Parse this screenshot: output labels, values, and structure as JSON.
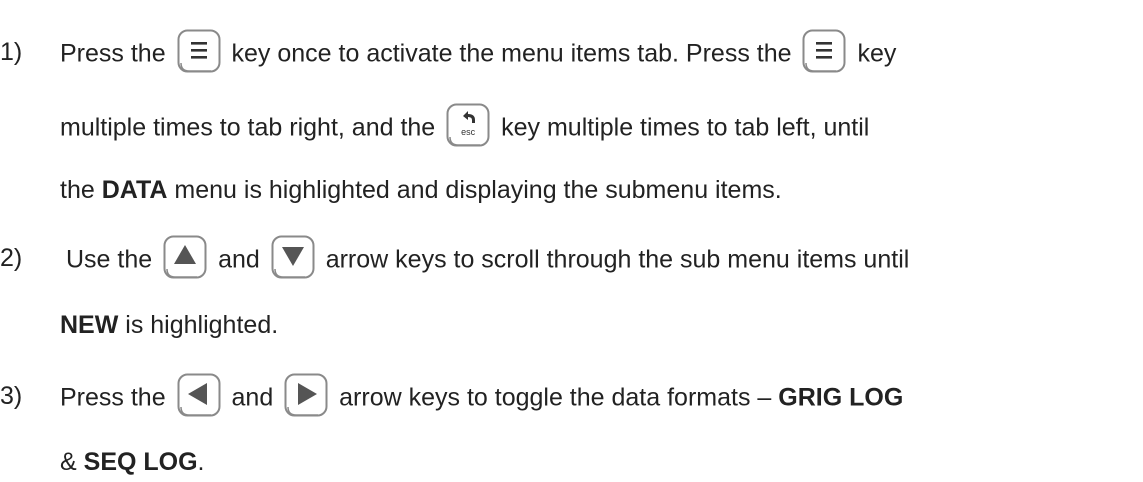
{
  "steps": [
    {
      "number": "1)",
      "lines": [
        [
          "Press the",
          "key once to activate the menu items tab.  Press the",
          "key"
        ],
        [
          "multiple times to tab right, and the",
          "key multiple times to tab left, until"
        ],
        [
          "the",
          "DATA",
          "menu is highlighted and displaying the submenu items."
        ]
      ]
    },
    {
      "number": "2)",
      "lines": [
        [
          "Use the",
          "and",
          "arrow keys to scroll through the sub menu items until"
        ],
        [
          "NEW",
          "is highlighted."
        ]
      ]
    },
    {
      "number": "3)",
      "lines": [
        [
          "Press the",
          "and",
          "arrow keys to toggle the data formats –",
          "GRIG LOG"
        ],
        [
          "&",
          "SEQ LOG",
          "."
        ]
      ]
    }
  ],
  "keys": {
    "menu": "menu-icon",
    "esc": "esc",
    "up": "up-arrow-icon",
    "down": "down-arrow-icon",
    "left": "left-arrow-icon",
    "right": "right-arrow-icon"
  },
  "colors": {
    "text": "#222222",
    "key_border": "#8a8a8a",
    "arrow_fill": "#555555"
  }
}
